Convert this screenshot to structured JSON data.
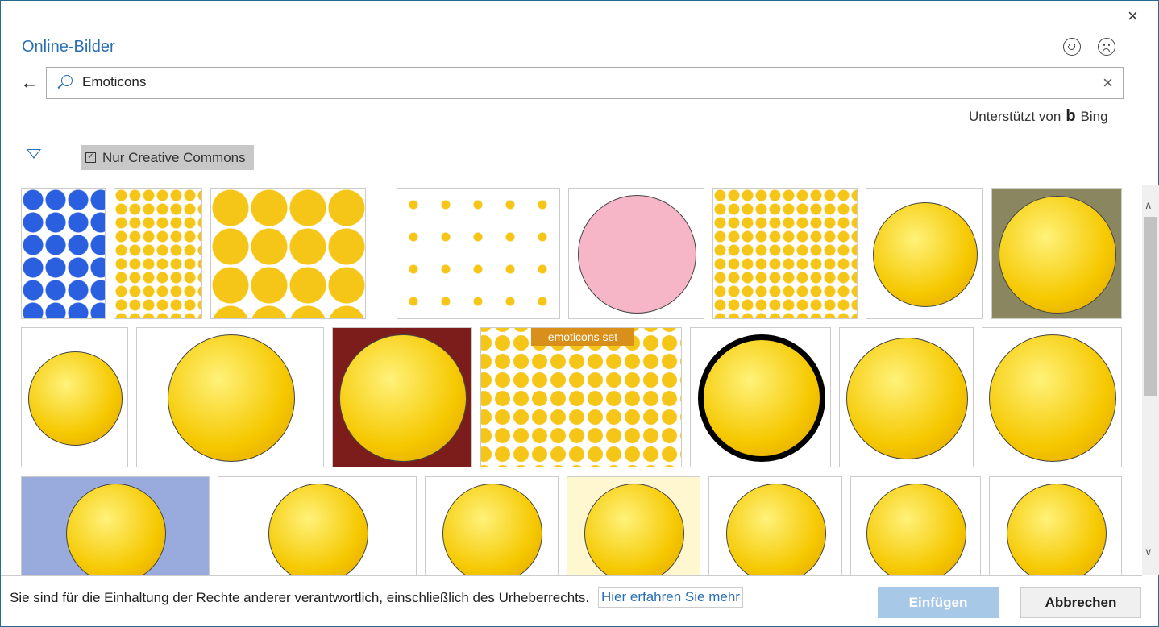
{
  "dialog": {
    "title": "Online-Bilder",
    "close_label": "×"
  },
  "feedback": {
    "like": "smiley-feedback",
    "dislike": "frown-feedback"
  },
  "search": {
    "value": "Emoticons",
    "clear_label": "×",
    "back_label": "←"
  },
  "powered_by": {
    "text": "Unterstützt von",
    "brand": "Bing",
    "brand_mark": "b"
  },
  "filter": {
    "creative_commons_label": "Nur Creative Commons",
    "creative_commons_checked": true,
    "check_mark": "✓"
  },
  "results": {
    "count": 22,
    "image_caption_set": "emoticons set"
  },
  "footer": {
    "legal_text": "Sie sind für die Einhaltung der Rechte anderer verantwortlich, einschließlich des Urheberrechts.",
    "learn_more": "Hier erfahren Sie mehr",
    "insert_label": "Einfügen",
    "cancel_label": "Abbrechen"
  },
  "scroll": {
    "up": "∧",
    "down": "∨"
  },
  "colors": {
    "accent": "#2b6fb3",
    "insert_disabled": "#a7c8e6"
  }
}
